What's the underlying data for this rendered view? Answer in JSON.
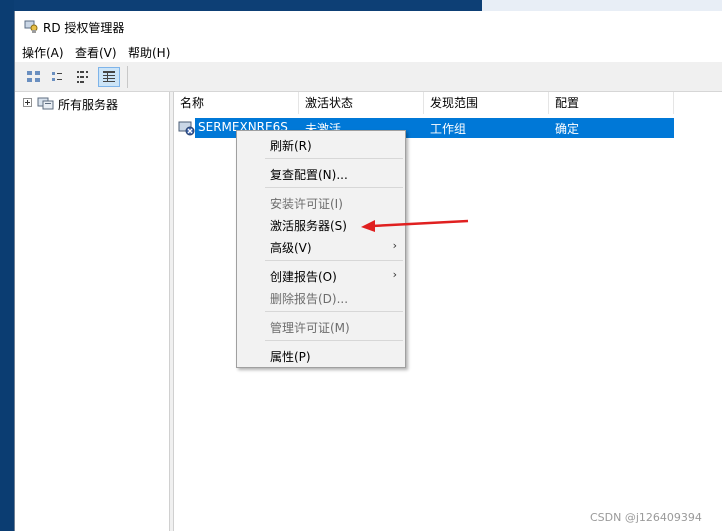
{
  "window": {
    "title": "RD 授权管理器"
  },
  "menubar": [
    {
      "label": "操作(A)"
    },
    {
      "label": "查看(V)"
    },
    {
      "label": "帮助(H)"
    }
  ],
  "tree": {
    "root_label": "所有服务器"
  },
  "table": {
    "columns": [
      "名称",
      "激活状态",
      "发现范围",
      "配置"
    ],
    "rows": [
      {
        "name": "SERMEXNRE6S",
        "status": "未激活",
        "scope": "工作组",
        "config": "确定"
      }
    ]
  },
  "context_menu": {
    "refresh": "刷新(R)",
    "review_config": "复查配置(N)...",
    "install_licenses": "安装许可证(I)",
    "activate_server": "激活服务器(S)",
    "advanced": "高级(V)",
    "create_report": "创建报告(O)",
    "delete_report": "删除报告(D)...",
    "manage_licenses": "管理许可证(M)",
    "properties": "属性(P)"
  },
  "watermark": "CSDN @j126409394",
  "colors": {
    "selection": "#0078d7",
    "annotation_arrow": "#e02020",
    "desktop": "#0b3d72"
  }
}
